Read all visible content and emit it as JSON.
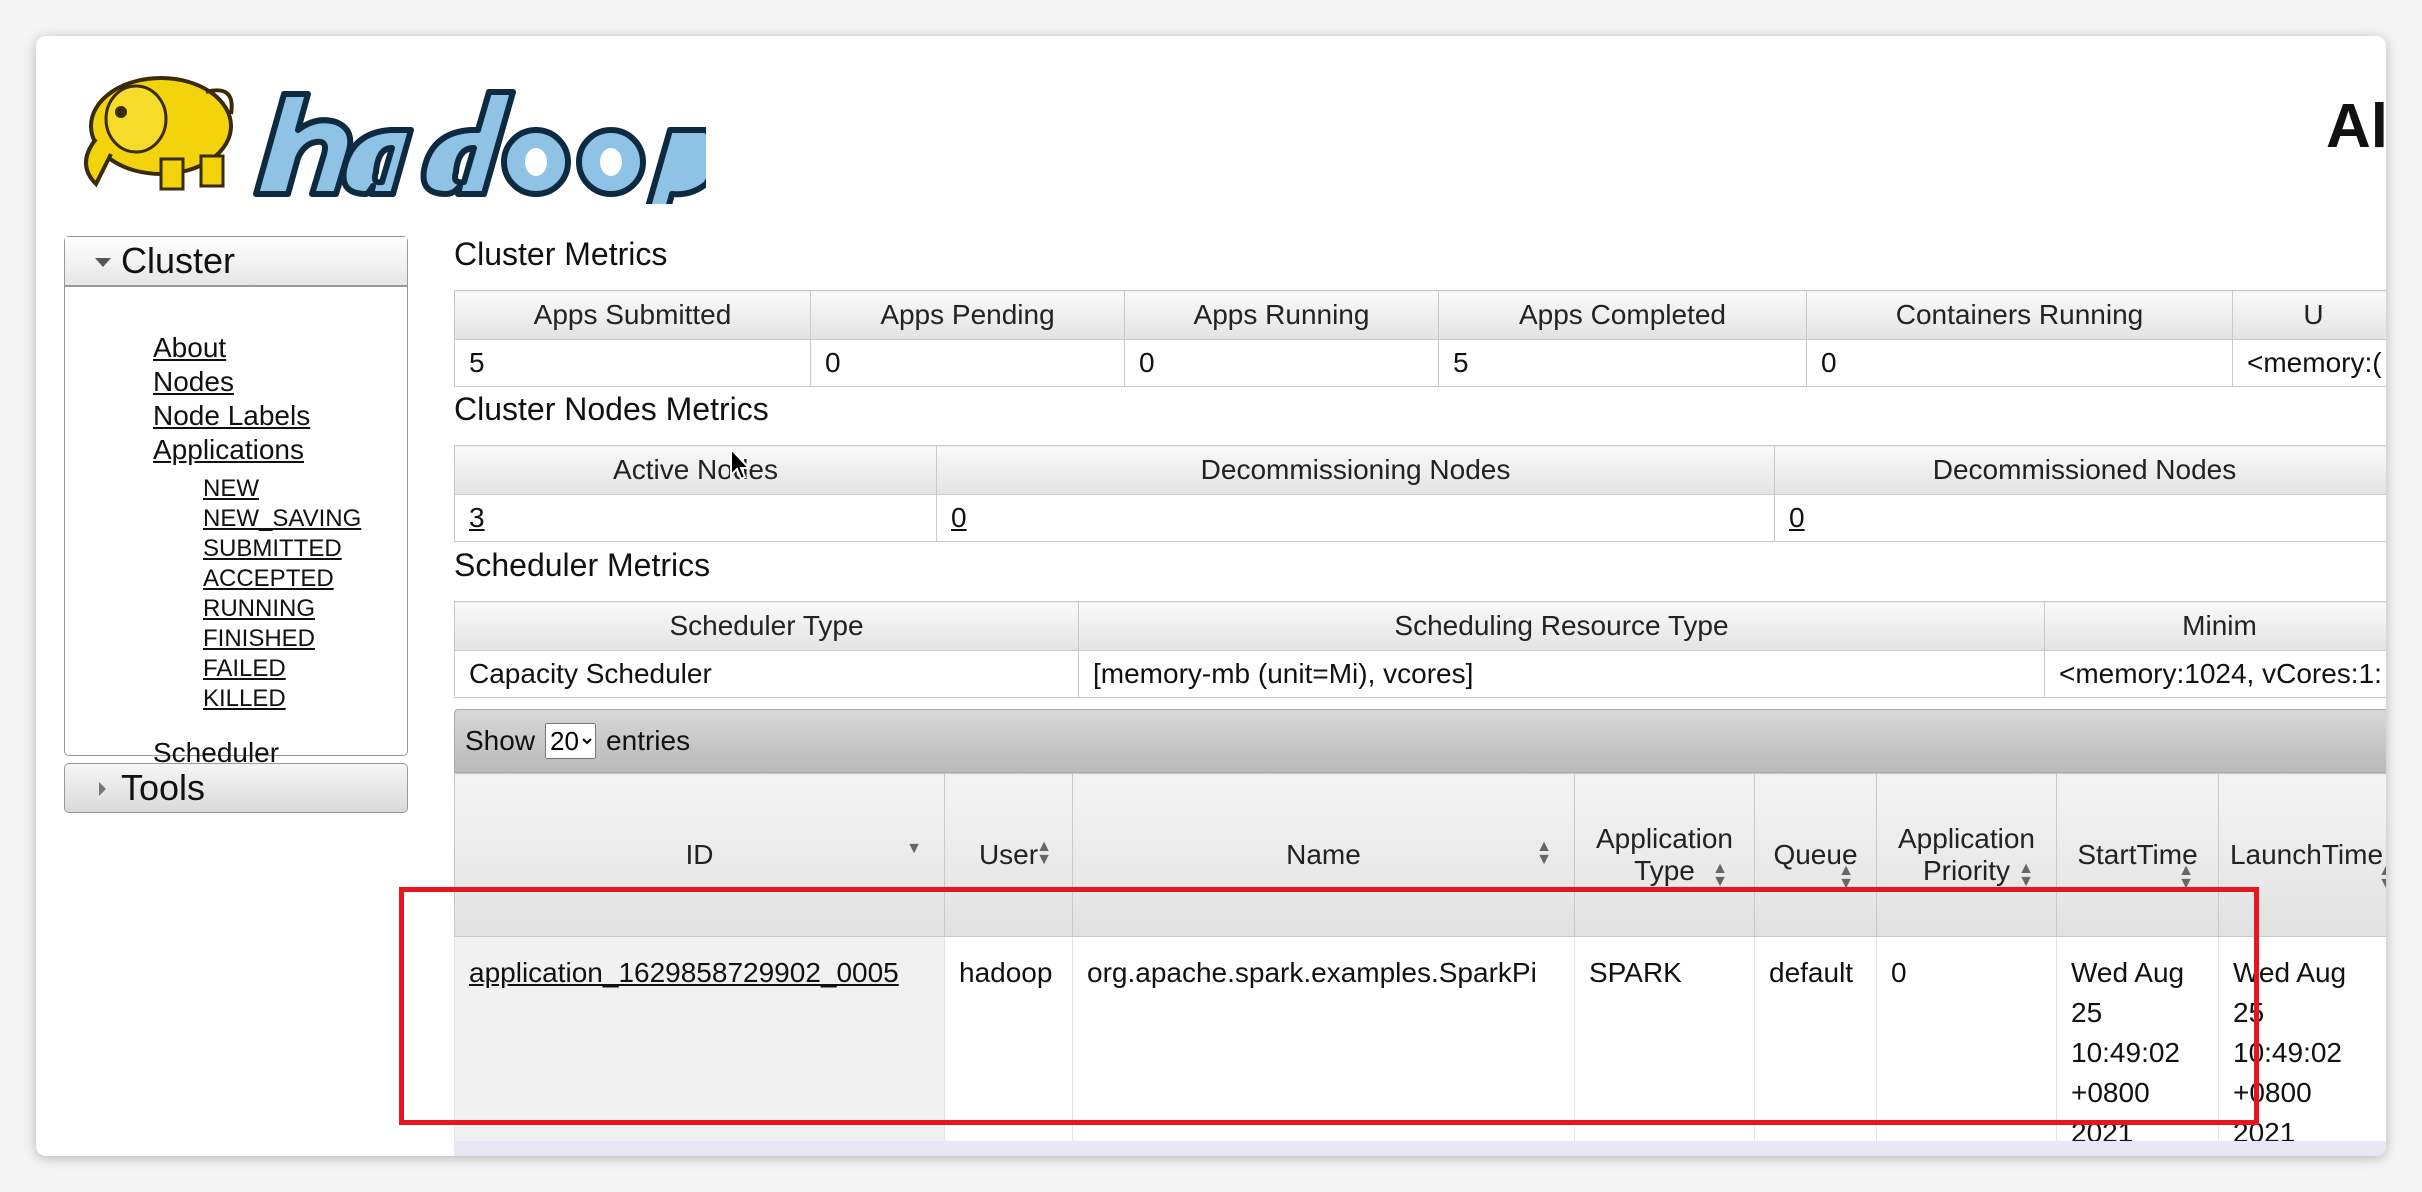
{
  "header": {
    "page_heading": "Al"
  },
  "nav": {
    "cluster_label": "Cluster",
    "links": [
      "About",
      "Nodes",
      "Node Labels",
      "Applications"
    ],
    "app_states": [
      "NEW",
      "NEW_SAVING",
      "SUBMITTED",
      "ACCEPTED",
      "RUNNING",
      "FINISHED",
      "FAILED",
      "KILLED"
    ],
    "scheduler": "Scheduler",
    "tools_label": "Tools"
  },
  "cluster_metrics": {
    "title": "Cluster Metrics",
    "headers": [
      "Apps Submitted",
      "Apps Pending",
      "Apps Running",
      "Apps Completed",
      "Containers Running",
      "U"
    ],
    "values": [
      "5",
      "0",
      "0",
      "5",
      "0",
      "<memory:("
    ]
  },
  "node_metrics": {
    "title": "Cluster Nodes Metrics",
    "headers": [
      "Active Nodes",
      "Decommissioning Nodes",
      "Decommissioned Nodes"
    ],
    "values": [
      "3",
      "0",
      "0"
    ]
  },
  "scheduler_metrics": {
    "title": "Scheduler Metrics",
    "headers": [
      "Scheduler Type",
      "Scheduling Resource Type",
      "Minim"
    ],
    "values": [
      "Capacity Scheduler",
      "[memory-mb (unit=Mi), vcores]",
      "<memory:1024, vCores:1:"
    ]
  },
  "show_entries": {
    "show": "Show",
    "value": "20",
    "options": [
      "20"
    ],
    "entries": "entries"
  },
  "apps_table": {
    "headers": {
      "id": "ID",
      "user": "User",
      "name": "Name",
      "app_type_1": "Application",
      "app_type_2": "Type",
      "queue": "Queue",
      "priority_1": "Application",
      "priority_2": "Priority",
      "start": "StartTime",
      "launch": "LaunchTime"
    },
    "row": {
      "id": "application_1629858729902_0005",
      "user": "hadoop",
      "name": "org.apache.spark.examples.SparkPi",
      "type": "SPARK",
      "queue": "default",
      "priority": "0",
      "start_lines": [
        "Wed Aug",
        "25",
        "10:49:02",
        "+0800",
        "2021"
      ],
      "launch_lines": [
        "Wed Aug",
        "25 10:49:02",
        "+0800 2021"
      ]
    }
  }
}
